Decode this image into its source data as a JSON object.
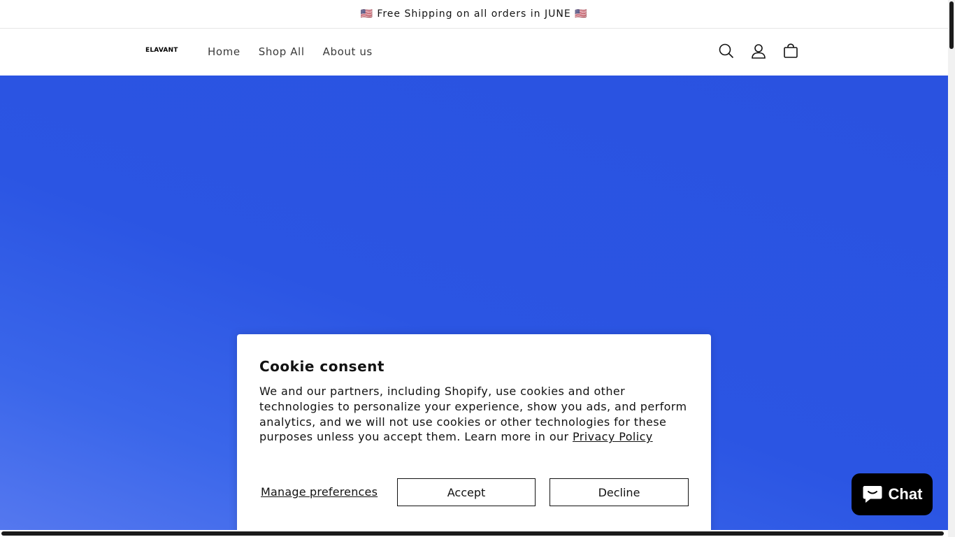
{
  "announcement": {
    "text": "🇺🇸 Free Shipping on all orders in JUNE 🇺🇸"
  },
  "header": {
    "logo": "ELAVANT",
    "nav": [
      {
        "label": "Home"
      },
      {
        "label": "Shop All"
      },
      {
        "label": "About us"
      }
    ],
    "icons": [
      "search-icon",
      "account-icon",
      "cart-icon"
    ]
  },
  "colors": {
    "hero": "#2b55e3",
    "chat_button": "#000000",
    "text": "#121212"
  },
  "cookie": {
    "title": "Cookie consent",
    "body": "We and our partners, including Shopify, use cookies and other technologies to personalize your experience, show you ads, and perform analytics, and we will not use cookies or other technologies for these purposes unless you accept them. Learn more in our ",
    "privacy_link": "Privacy Policy",
    "manage_label": "Manage preferences",
    "accept_label": "Accept",
    "decline_label": "Decline"
  },
  "chat": {
    "label": "Chat",
    "icon": "chat-bubble-icon"
  }
}
